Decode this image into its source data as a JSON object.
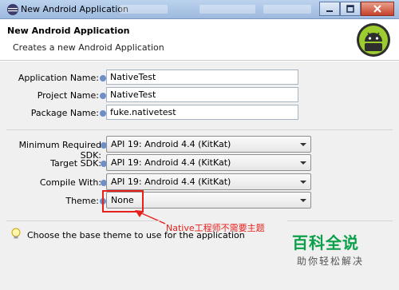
{
  "window": {
    "title": "New Android Application",
    "icon": "eclipse-window-icon",
    "controls": [
      "minimize-icon",
      "maximize-icon",
      "close-icon"
    ]
  },
  "header": {
    "title": "New Android Application",
    "subtitle": "Creates a new Android Application",
    "logo": "android-logo"
  },
  "form": {
    "app_name": {
      "label": "Application Name:",
      "value": "NativeTest"
    },
    "project_name": {
      "label": "Project Name:",
      "value": "NativeTest"
    },
    "package_name": {
      "label": "Package Name:",
      "value": "fuke.nativetest"
    },
    "min_sdk": {
      "label": "Minimum Required SDK:",
      "value": "API 19: Android 4.4 (KitKat)"
    },
    "target_sdk": {
      "label": "Target SDK:",
      "value": "API 19: Android 4.4 (KitKat)"
    },
    "compile_with": {
      "label": "Compile With:",
      "value": "API 19: Android 4.4 (KitKat)"
    },
    "theme": {
      "label": "Theme:",
      "value": "None"
    }
  },
  "annotation": {
    "text": "Native工程师不需要主题",
    "color": "#e8201c"
  },
  "tip": {
    "icon": "lightbulb-icon",
    "text": "Choose the base theme to use for the application"
  },
  "watermark": {
    "main": "百科全说",
    "sub": "助你轻松解决"
  }
}
